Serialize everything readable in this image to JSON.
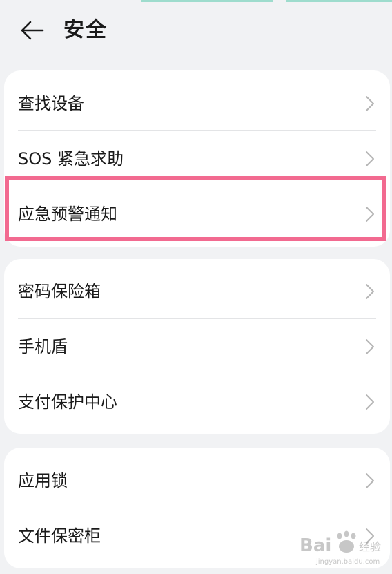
{
  "header": {
    "title": "安全",
    "back_icon": "arrow-left-icon"
  },
  "groups": [
    {
      "items": [
        {
          "label": "查找设备",
          "icon": "chevron-right-icon"
        },
        {
          "label": "SOS 紧急求助",
          "icon": "chevron-right-icon"
        },
        {
          "label": "应急预警通知",
          "icon": "chevron-right-icon",
          "highlighted": true
        }
      ]
    },
    {
      "items": [
        {
          "label": "密码保险箱",
          "icon": "chevron-right-icon"
        },
        {
          "label": "手机盾",
          "icon": "chevron-right-icon"
        },
        {
          "label": "支付保护中心",
          "icon": "chevron-right-icon"
        }
      ]
    },
    {
      "items": [
        {
          "label": "应用锁",
          "icon": "chevron-right-icon"
        },
        {
          "label": "文件保密柜",
          "icon": "chevron-right-icon"
        }
      ]
    }
  ],
  "colors": {
    "background": "#f1f2f4",
    "card": "#ffffff",
    "highlight_border": "#f26a90",
    "chevron": "#b5b5b5",
    "divider": "#e3e4e6"
  },
  "watermark": {
    "text": "jingyan.baidu.com"
  }
}
